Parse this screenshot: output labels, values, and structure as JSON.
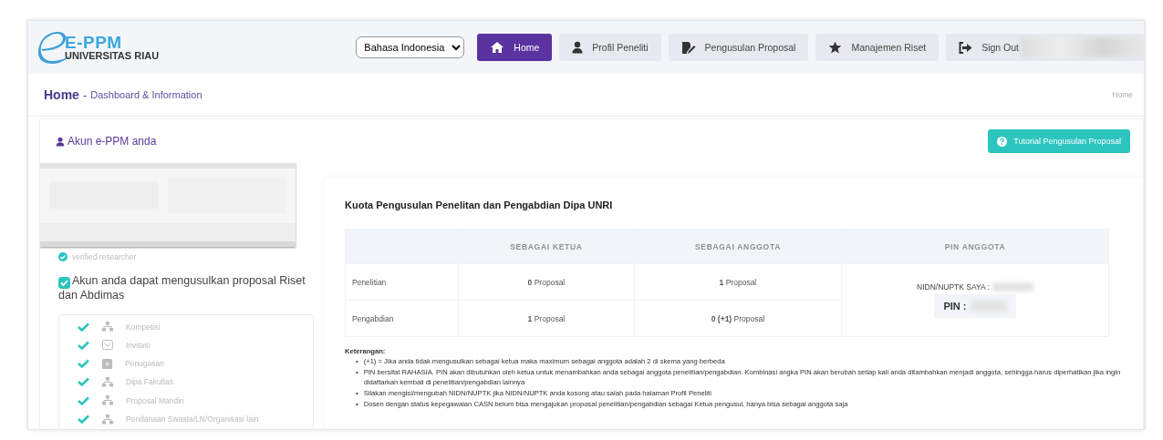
{
  "header": {
    "logo": {
      "mark": "E-PPM",
      "subtitle": "UNIVERSITAS RIAU"
    },
    "language": "Bahasa Indonesia",
    "nav": [
      {
        "label": "Home",
        "kind": "home",
        "selected": true
      },
      {
        "label": "Profil Peneliti",
        "kind": "user",
        "selected": false
      },
      {
        "label": "Pengusulan Proposal",
        "kind": "doc",
        "selected": false
      },
      {
        "label": "Manajemen Riset",
        "kind": "star",
        "selected": false
      },
      {
        "label": "Sign Out",
        "kind": "signout",
        "selected": false
      }
    ]
  },
  "breadcrumb": {
    "title": "Home",
    "separator": "-",
    "subtitle": "Dashboard & Information",
    "trail": "Home"
  },
  "account": {
    "title": "Akun e-PPM anda",
    "tutorial_button": "Tutorial Pengusulan Proposal",
    "verified": "verified researcher",
    "eligibility": {
      "checked": true,
      "text": "Akun anda dapat mengusulkan proposal Riset dan Abdimas"
    },
    "schemes": [
      {
        "label": "Kompetisi",
        "kind": "sitemap",
        "checked": true
      },
      {
        "label": "Invitasi",
        "kind": "envelope",
        "checked": true
      },
      {
        "label": "Penugasan",
        "kind": "square",
        "checked": true
      },
      {
        "label": "Dipa Fakultas",
        "kind": "sitemap",
        "checked": true
      },
      {
        "label": "Proposal Mandiri",
        "kind": "sitemap",
        "checked": true
      },
      {
        "label": "Pendanaan Swasta/LN/Organisasi lain",
        "kind": "sitemap",
        "checked": true
      }
    ]
  },
  "quota": {
    "title": "Kuota Pengusulan Penelitan dan Pengabdian Dipa UNRI",
    "columns": [
      "SEBAGAI KETUA",
      "SEBAGAI ANGGOTA",
      "PIN ANGGOTA"
    ],
    "rows": [
      {
        "label": "Penelitian",
        "ketua": "**0** Proposal",
        "anggota": "**1** Proposal"
      },
      {
        "label": "Pengabdian",
        "ketua": "**1** Proposal",
        "anggota": "**0 (+1)** Proposal"
      }
    ],
    "nidn_label": "NIDN/NUPTK SAYA :",
    "pin_label": "PIN :"
  },
  "notes": {
    "title": "Keterangan:",
    "marker": "•",
    "items": [
      "(+1) = Jika anda tidak mengusulkan sebagai ketua maka maximum sebagai anggota adalah 2 di skema yang berbeda",
      "PIN bersifat RAHASIA. PIN akan dibutuhkan oleh ketua untuk menambahkan anda sebagai anggota penelitian/pengabdian. Kombinasi angka PIN akan berubah setiap kali anda ditambahkan menjadi anggota, sehingga harus diperhatikan jika ingin didaftarkan kembali di penelitian/pengabdian lainnya",
      "Silakan mengisi/mengubah NIDN/NUPTK jika NIDN/NUPTK anda kosong atau salah pada halaman Profil Peneliti",
      "Dosen dengan status kepegawaian CASN belum bisa mengajukan proposal penelitian/pengabdian sebagai Ketua pengusul, hanya bisa sebagai anggota saja"
    ]
  }
}
